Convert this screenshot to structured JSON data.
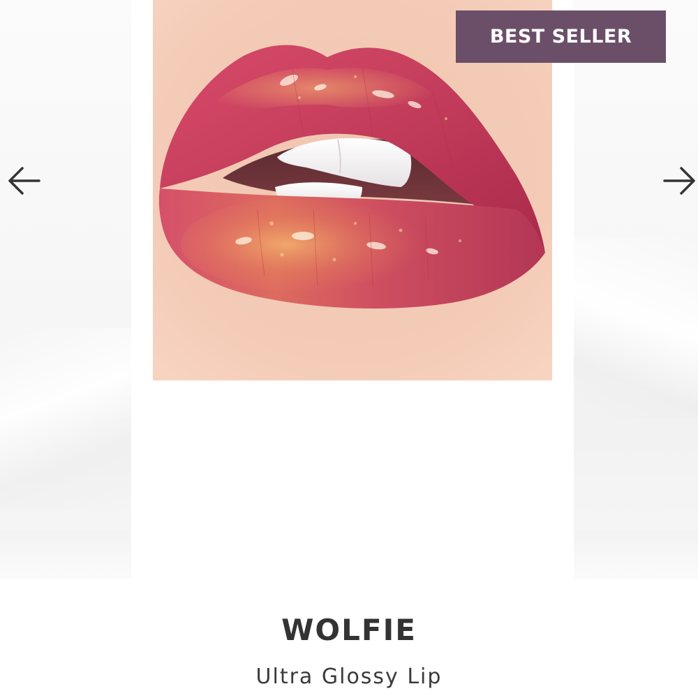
{
  "carousel": {
    "badge_label": "BEST SELLER",
    "prev_icon": "arrow-left-icon",
    "next_icon": "arrow-right-icon",
    "image_subject": "glossy pink-red lips with gold shimmer"
  },
  "product": {
    "name": "WOLFIE",
    "subtitle": "Ultra Glossy Lip"
  },
  "colors": {
    "badge_bg": "#6b4f68",
    "badge_text": "#ffffff",
    "name_text": "#333333",
    "arrow": "#333333",
    "lip_base": "#c73a5a",
    "skin": "#f0c9b5"
  }
}
